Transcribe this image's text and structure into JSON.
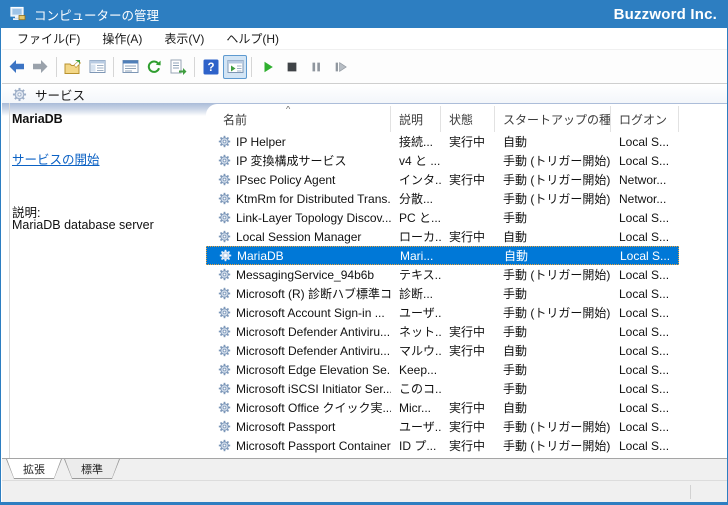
{
  "window": {
    "title": "コンピューターの管理",
    "brand": "Buzzword Inc."
  },
  "menu": {
    "items": [
      {
        "id": "file",
        "label": "ファイル(F)"
      },
      {
        "id": "action",
        "label": "操作(A)"
      },
      {
        "id": "view",
        "label": "表示(V)"
      },
      {
        "id": "help",
        "label": "ヘルプ(H)"
      }
    ]
  },
  "toolbar": {
    "buttons": [
      {
        "icon": "back-icon"
      },
      {
        "icon": "forward-icon",
        "disabled": true
      },
      {
        "sep": true
      },
      {
        "icon": "up-folder-icon"
      },
      {
        "icon": "console-tree-icon"
      },
      {
        "sep": true
      },
      {
        "icon": "properties-icon"
      },
      {
        "icon": "refresh-icon"
      },
      {
        "icon": "export-list-icon"
      },
      {
        "sep": true
      },
      {
        "icon": "help-icon"
      },
      {
        "icon": "action-pane-icon",
        "active": true
      },
      {
        "sep": true
      },
      {
        "icon": "start-service-icon"
      },
      {
        "icon": "stop-service-icon",
        "disabled": true
      },
      {
        "icon": "pause-service-icon",
        "disabled": true
      },
      {
        "icon": "resume-service-icon",
        "disabled": true
      }
    ]
  },
  "pane": {
    "title": "サービス"
  },
  "sidebar": {
    "service_name": "MariaDB",
    "start_link": "サービスの開始",
    "description_label": "説明:",
    "description": "MariaDB database server"
  },
  "table": {
    "sort_indicator": "^",
    "columns": [
      {
        "id": "name",
        "label": "名前"
      },
      {
        "id": "desc",
        "label": "説明"
      },
      {
        "id": "status",
        "label": "状態"
      },
      {
        "id": "startup",
        "label": "スタートアップの種類"
      },
      {
        "id": "logon",
        "label": "ログオン"
      }
    ],
    "rows": [
      {
        "name": "IP Helper",
        "desc": "接続...",
        "status": "実行中",
        "startup": "自動",
        "logon": "Local S...",
        "selected": false
      },
      {
        "name": "IP 変換構成サービス",
        "desc": "v4 と ...",
        "status": "",
        "startup": "手動 (トリガー開始)",
        "logon": "Local S...",
        "selected": false
      },
      {
        "name": "IPsec Policy Agent",
        "desc": "インタ...",
        "status": "実行中",
        "startup": "手動 (トリガー開始)",
        "logon": "Networ...",
        "selected": false
      },
      {
        "name": "KtmRm for Distributed Trans...",
        "desc": "分散...",
        "status": "",
        "startup": "手動 (トリガー開始)",
        "logon": "Networ...",
        "selected": false
      },
      {
        "name": "Link-Layer Topology Discov...",
        "desc": "PC と...",
        "status": "",
        "startup": "手動",
        "logon": "Local S...",
        "selected": false
      },
      {
        "name": "Local Session Manager",
        "desc": "ローカ...",
        "status": "実行中",
        "startup": "自動",
        "logon": "Local S...",
        "selected": false
      },
      {
        "name": "MariaDB",
        "desc": "Mari...",
        "status": "",
        "startup": "自動",
        "logon": "Local S...",
        "selected": true
      },
      {
        "name": "MessagingService_94b6b",
        "desc": "テキス...",
        "status": "",
        "startup": "手動 (トリガー開始)",
        "logon": "Local S...",
        "selected": false
      },
      {
        "name": "Microsoft (R) 診断ハブ標準コ...",
        "desc": "診断...",
        "status": "",
        "startup": "手動",
        "logon": "Local S...",
        "selected": false
      },
      {
        "name": "Microsoft Account Sign-in ...",
        "desc": "ユーザ...",
        "status": "",
        "startup": "手動 (トリガー開始)",
        "logon": "Local S...",
        "selected": false
      },
      {
        "name": "Microsoft Defender Antiviru...",
        "desc": "ネット...",
        "status": "実行中",
        "startup": "手動",
        "logon": "Local S...",
        "selected": false
      },
      {
        "name": "Microsoft Defender Antiviru...",
        "desc": "マルウ...",
        "status": "実行中",
        "startup": "自動",
        "logon": "Local S...",
        "selected": false
      },
      {
        "name": "Microsoft Edge Elevation Se...",
        "desc": "Keep...",
        "status": "",
        "startup": "手動",
        "logon": "Local S...",
        "selected": false
      },
      {
        "name": "Microsoft iSCSI Initiator Ser...",
        "desc": "このコ...",
        "status": "",
        "startup": "手動",
        "logon": "Local S...",
        "selected": false
      },
      {
        "name": "Microsoft Office クイック実...",
        "desc": "Micr...",
        "status": "実行中",
        "startup": "自動",
        "logon": "Local S...",
        "selected": false
      },
      {
        "name": "Microsoft Passport",
        "desc": "ユーザ...",
        "status": "実行中",
        "startup": "手動 (トリガー開始)",
        "logon": "Local S...",
        "selected": false
      },
      {
        "name": "Microsoft Passport Container",
        "desc": "ID プ...",
        "status": "実行中",
        "startup": "手動 (トリガー開始)",
        "logon": "Local S...",
        "selected": false
      }
    ]
  },
  "tabs": {
    "active": "extended",
    "items": [
      {
        "id": "extended",
        "label": "拡張"
      },
      {
        "id": "standard",
        "label": "標準"
      }
    ]
  },
  "colors": {
    "titlebar_blue": "#2d7ec1",
    "selection_blue": "#0078d7",
    "link_blue": "#0b61c4",
    "band_blue": "#a9bbd8"
  }
}
